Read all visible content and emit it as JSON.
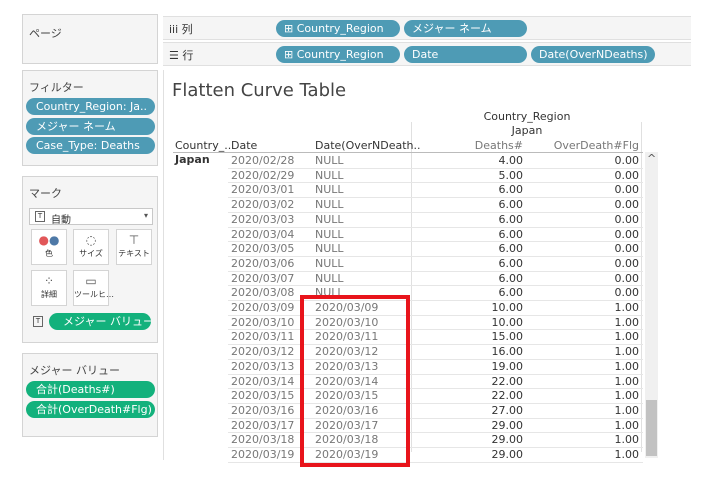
{
  "left": {
    "pages_title": "ページ",
    "filters_title": "フィルター",
    "filters": [
      "Country_Region: Ja..",
      "メジャー ネーム",
      "Case_Type: Deaths"
    ],
    "marks_title": "マーク",
    "mark_type": "自動",
    "mark_buttons": [
      "色",
      "サイズ",
      "テキスト",
      "詳細",
      "ツールヒ…"
    ],
    "measure_values_pill": "メジャー バリュー",
    "measure_values_title": "メジャー バリュー",
    "measure_values": [
      "合計(Deaths#)",
      "合計(OverDeath#Flg)"
    ]
  },
  "shelves": {
    "columns_label": "列",
    "columns": [
      "Country_Region",
      "メジャー ネーム"
    ],
    "rows_label": "行",
    "rows": [
      "Country_Region",
      "Date",
      "Date(OverNDeaths)"
    ]
  },
  "view": {
    "title": "Flatten Curve Table",
    "header_top": "Country_Region",
    "header_country": "Japan",
    "col_country": "Country_..",
    "col_date": "Date",
    "col_dateover": "Date(OverNDeath..",
    "col_deaths": "Deaths#",
    "col_flg": "OverDeath#Flg",
    "row_country": "Japan",
    "rows": [
      {
        "date": "2020/02/28",
        "over": "NULL",
        "deaths": "4.00",
        "flg": "0.00"
      },
      {
        "date": "2020/02/29",
        "over": "NULL",
        "deaths": "5.00",
        "flg": "0.00"
      },
      {
        "date": "2020/03/01",
        "over": "NULL",
        "deaths": "6.00",
        "flg": "0.00"
      },
      {
        "date": "2020/03/02",
        "over": "NULL",
        "deaths": "6.00",
        "flg": "0.00"
      },
      {
        "date": "2020/03/03",
        "over": "NULL",
        "deaths": "6.00",
        "flg": "0.00"
      },
      {
        "date": "2020/03/04",
        "over": "NULL",
        "deaths": "6.00",
        "flg": "0.00"
      },
      {
        "date": "2020/03/05",
        "over": "NULL",
        "deaths": "6.00",
        "flg": "0.00"
      },
      {
        "date": "2020/03/06",
        "over": "NULL",
        "deaths": "6.00",
        "flg": "0.00"
      },
      {
        "date": "2020/03/07",
        "over": "NULL",
        "deaths": "6.00",
        "flg": "0.00"
      },
      {
        "date": "2020/03/08",
        "over": "NULL",
        "deaths": "6.00",
        "flg": "0.00"
      },
      {
        "date": "2020/03/09",
        "over": "2020/03/09",
        "deaths": "10.00",
        "flg": "1.00"
      },
      {
        "date": "2020/03/10",
        "over": "2020/03/10",
        "deaths": "10.00",
        "flg": "1.00"
      },
      {
        "date": "2020/03/11",
        "over": "2020/03/11",
        "deaths": "15.00",
        "flg": "1.00"
      },
      {
        "date": "2020/03/12",
        "over": "2020/03/12",
        "deaths": "16.00",
        "flg": "1.00"
      },
      {
        "date": "2020/03/13",
        "over": "2020/03/13",
        "deaths": "19.00",
        "flg": "1.00"
      },
      {
        "date": "2020/03/14",
        "over": "2020/03/14",
        "deaths": "22.00",
        "flg": "1.00"
      },
      {
        "date": "2020/03/15",
        "over": "2020/03/15",
        "deaths": "22.00",
        "flg": "1.00"
      },
      {
        "date": "2020/03/16",
        "over": "2020/03/16",
        "deaths": "27.00",
        "flg": "1.00"
      },
      {
        "date": "2020/03/17",
        "over": "2020/03/17",
        "deaths": "29.00",
        "flg": "1.00"
      },
      {
        "date": "2020/03/18",
        "over": "2020/03/18",
        "deaths": "29.00",
        "flg": "1.00"
      },
      {
        "date": "2020/03/19",
        "over": "2020/03/19",
        "deaths": "29.00",
        "flg": "1.00"
      }
    ],
    "highlight_color": "#e8141b"
  },
  "scroll_up_glyph": "^"
}
